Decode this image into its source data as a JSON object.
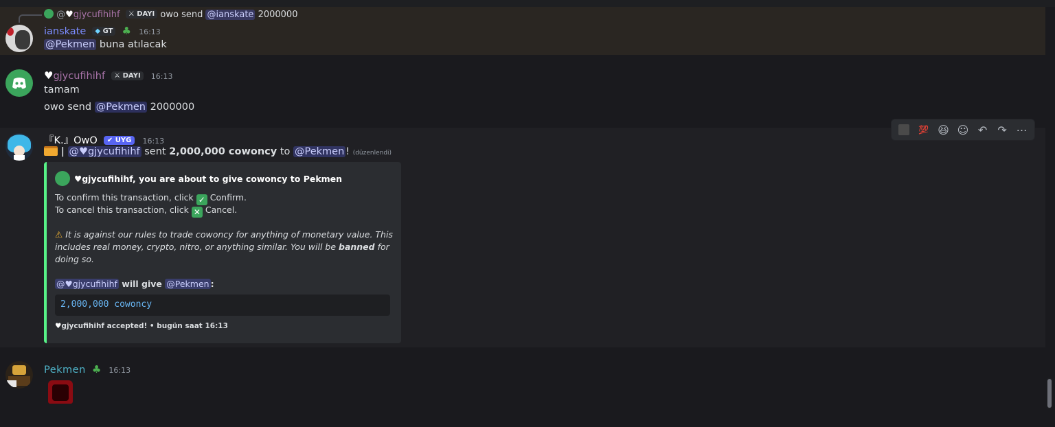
{
  "reply": {
    "author_prefix": "@",
    "author": "gjycufihihf",
    "tag": "DAYI",
    "text_before": "owo send",
    "mention": "@ianskate",
    "text_after": "2000000"
  },
  "msg1": {
    "author": "ianskate",
    "tag": "GT",
    "time": "16:13",
    "mention": "@Pekmen",
    "text": "buna atılacak"
  },
  "msg2": {
    "author": "gjycufihihf",
    "tag": "DAYI",
    "time": "16:13",
    "line1": "tamam",
    "line2_before": "owo send",
    "line2_mention": "@Pekmen",
    "line2_after": "2000000"
  },
  "msg3": {
    "author": "『K.』OwO",
    "tag": "UYG",
    "time": "16:13",
    "line_mention": "@♥gjycufihihf",
    "line_sent": "sent",
    "line_amount": "2,000,000 cowoncy",
    "line_to": "to",
    "line_mention2": "@Pekmen",
    "line_excl": "!",
    "edited": "(düzenlendi)",
    "embed": {
      "title": "gjycufihihf, you are about to give cowoncy to Pekmen",
      "confirm_before": "To confirm this transaction, click",
      "confirm_after": "Confirm.",
      "cancel_before": "To cancel this transaction, click",
      "cancel_after": "Cancel.",
      "warning_1": "It is against our rules to trade cowoncy for anything of monetary value. This",
      "warning_2a": "includes real money, crypto, nitro, or anything similar. You will be",
      "warning_banned": "banned",
      "warning_2b": "for",
      "warning_3": "doing so.",
      "give_mention": "@♥gjycufihihf",
      "give_text": "will give",
      "give_mention2": "@Pekmen",
      "give_colon": ":",
      "code": "2,000,000 cowoncy",
      "footer": "gjycufihihf accepted! • bugün saat 16:13"
    }
  },
  "msg4": {
    "author": "Pekmen",
    "time": "16:13"
  },
  "toolbar": {
    "items": [
      "reaction-boot",
      "💯",
      "😆",
      "add-reaction",
      "reply",
      "forward",
      "more"
    ]
  },
  "colors": {
    "accent": "#5865f2",
    "embed_border": "#57f287",
    "mention_bg": "#3c4270"
  }
}
